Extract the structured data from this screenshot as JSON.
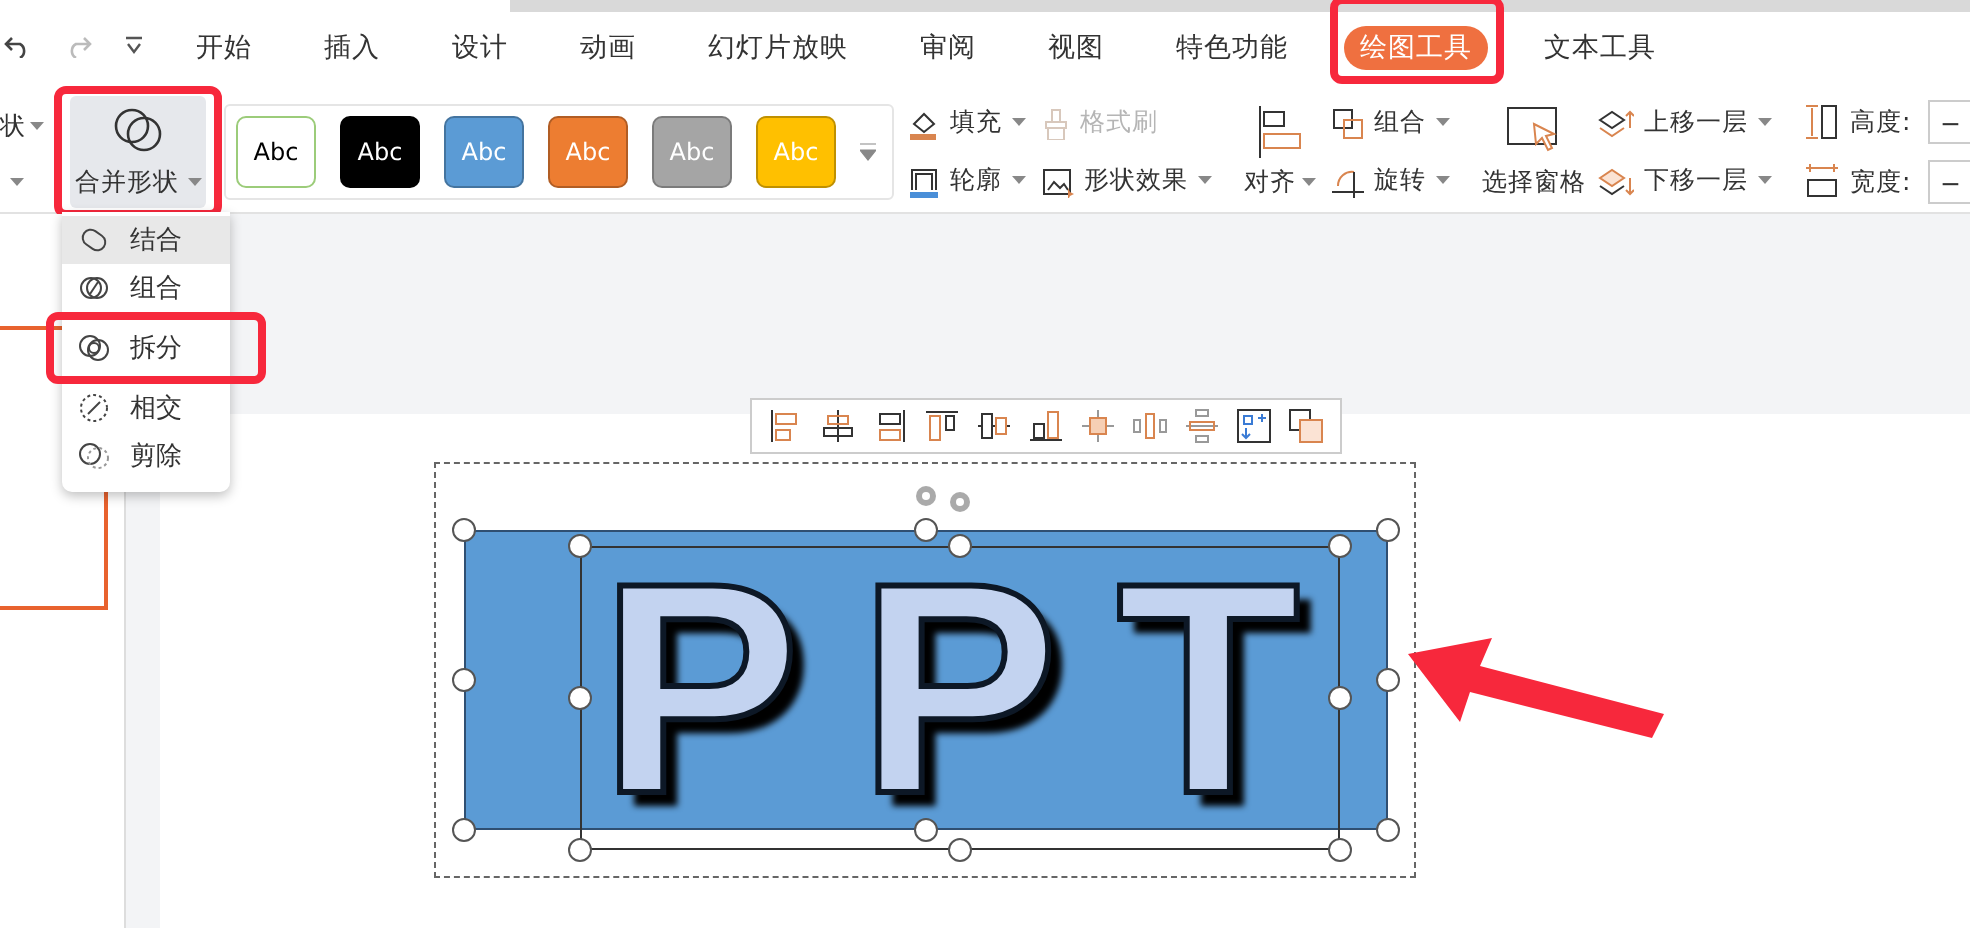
{
  "tabs": [
    {
      "label": "开始",
      "selected": false,
      "highlighted": false
    },
    {
      "label": "插入",
      "selected": false,
      "highlighted": false
    },
    {
      "label": "设计",
      "selected": false,
      "highlighted": false
    },
    {
      "label": "动画",
      "selected": false,
      "highlighted": false
    },
    {
      "label": "幻灯片放映",
      "selected": false,
      "highlighted": false
    },
    {
      "label": "审阅",
      "selected": false,
      "highlighted": false
    },
    {
      "label": "视图",
      "selected": false,
      "highlighted": false
    },
    {
      "label": "特色功能",
      "selected": false,
      "highlighted": false
    },
    {
      "label": "绘图工具",
      "selected": true,
      "highlighted": true
    },
    {
      "label": "文本工具",
      "selected": false,
      "highlighted": false
    }
  ],
  "ribbon": {
    "cut_label": "状",
    "merge_shapes": {
      "label": "合并形状",
      "pressed": true,
      "highlighted": true
    },
    "style_presets": [
      {
        "label": "Abc",
        "color": "#ffffff",
        "kind": "outline"
      },
      {
        "label": "Abc",
        "color": "#000000",
        "kind": "filled"
      },
      {
        "label": "Abc",
        "color": "#5b9bd5",
        "kind": "filled"
      },
      {
        "label": "Abc",
        "color": "#ed7d31",
        "kind": "filled"
      },
      {
        "label": "Abc",
        "color": "#a5a5a5",
        "kind": "filled"
      },
      {
        "label": "Abc",
        "color": "#ffc000",
        "kind": "filled"
      }
    ],
    "format_buttons": [
      {
        "label": "填充",
        "disabled": false
      },
      {
        "label": "格式刷",
        "disabled": true
      },
      {
        "label": "轮廓",
        "disabled": false
      },
      {
        "label": "形状效果",
        "disabled": false
      }
    ],
    "arrange": {
      "align": "对齐",
      "group": "组合",
      "rotate": "旋转",
      "selection_pane": "选择窗格",
      "bring_forward": "上移一层",
      "send_backward": "下移一层"
    },
    "size": [
      {
        "label": "高度:",
        "button": "−"
      },
      {
        "label": "宽度:",
        "button": "−"
      }
    ]
  },
  "merge_menu": [
    {
      "label": "结合",
      "selected": true,
      "highlighted": false
    },
    {
      "label": "组合",
      "selected": false,
      "highlighted": false
    },
    {
      "label": "拆分",
      "selected": false,
      "highlighted": true
    },
    {
      "label": "相交",
      "selected": false,
      "highlighted": false
    },
    {
      "label": "剪除",
      "selected": false,
      "highlighted": false
    }
  ],
  "slide": {
    "letters": [
      "P",
      "P",
      "T"
    ]
  }
}
